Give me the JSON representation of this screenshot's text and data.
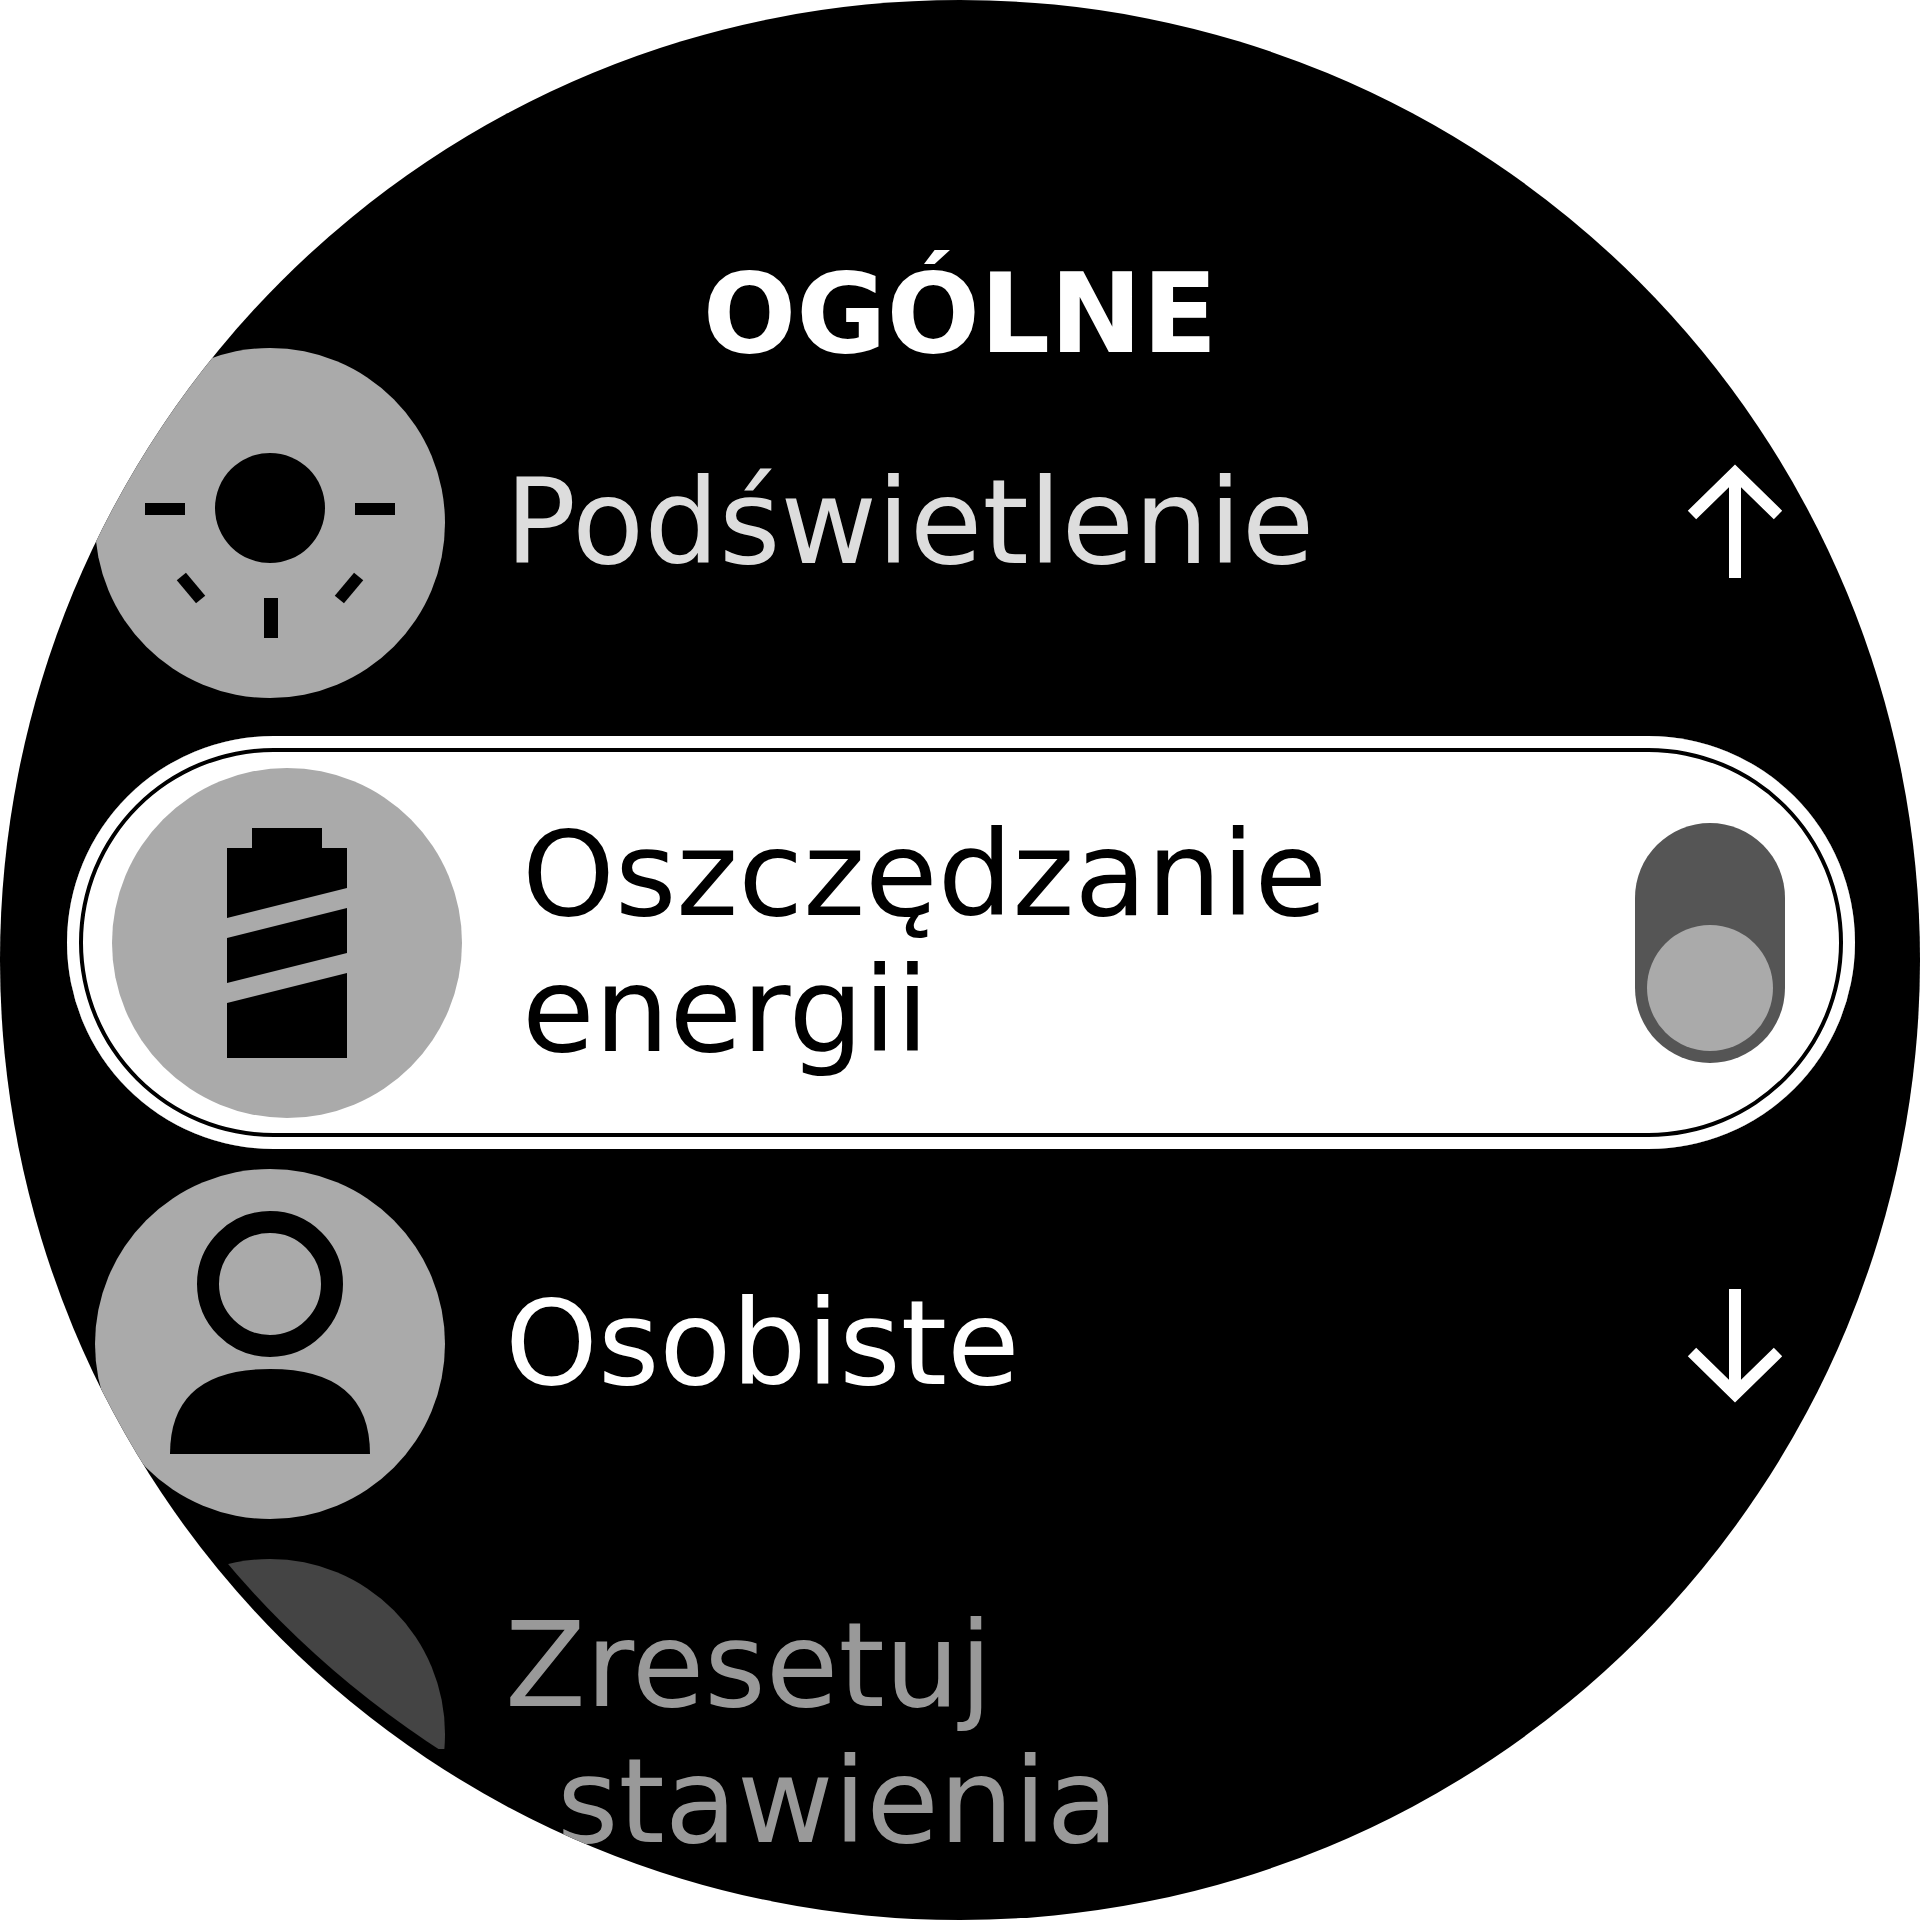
{
  "title": "OGÓLNE",
  "items": [
    {
      "kind": "nav-up",
      "label": "Podświetlenie",
      "selected": false
    },
    {
      "kind": "toggle",
      "label": "Oszczędzanie energii",
      "on": false,
      "selected": true
    },
    {
      "kind": "nav-down",
      "label": "Osobiste",
      "selected": false
    },
    {
      "kind": "nav",
      "label": "Zresetuj",
      "label2": "stawienia",
      "selected": false
    }
  ]
}
